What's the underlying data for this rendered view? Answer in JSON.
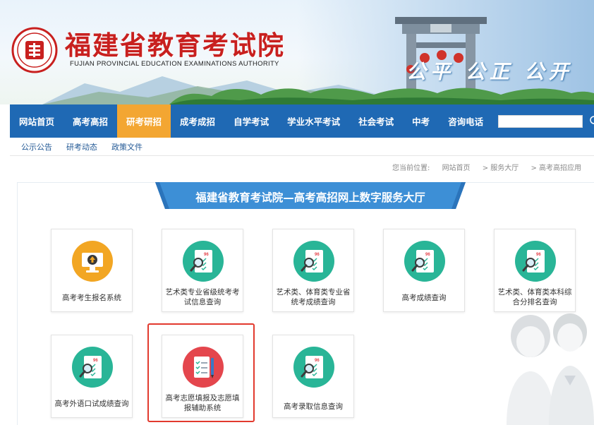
{
  "header": {
    "title": "福建省教育考试院",
    "subtitle": "FUJIAN PROVINCIAL EDUCATION EXAMINATIONS AUTHORITY",
    "slogan": "公平 公正 公开",
    "seal_icon": "exam-authority-seal"
  },
  "nav": {
    "items": [
      {
        "label": "网站首页",
        "active": false
      },
      {
        "label": "高考高招",
        "active": false
      },
      {
        "label": "研考研招",
        "active": true
      },
      {
        "label": "成考成招",
        "active": false
      },
      {
        "label": "自学考试",
        "active": false
      },
      {
        "label": "学业水平考试",
        "active": false
      },
      {
        "label": "社会考试",
        "active": false
      },
      {
        "label": "中考",
        "active": false
      },
      {
        "label": "咨询电话",
        "active": false
      }
    ],
    "search_value": "",
    "search_icon": "search-icon"
  },
  "subnav": {
    "items": [
      "公示公告",
      "研考动态",
      "政策文件"
    ]
  },
  "breadcrumb": {
    "prefix": "您当前位置:",
    "items": [
      "网站首页",
      "> 服务大厅",
      "> 高考高招应用"
    ]
  },
  "hall": {
    "title": "福建省教育考试院—高考高招网上数字服务大厅"
  },
  "services": [
    {
      "label": "高考考生报名系统",
      "icon": "upload-monitor-icon",
      "color": "#f2a623"
    },
    {
      "label": "艺术类专业省级统考考试信息查询",
      "icon": "score-query-icon",
      "color": "#29b597"
    },
    {
      "label": "艺术类、体育类专业省统考成绩查询",
      "icon": "score-query-icon",
      "color": "#29b597"
    },
    {
      "label": "高考成绩查询",
      "icon": "score-query-icon",
      "color": "#29b597"
    },
    {
      "label": "艺术类、体育类本科综合分排名查询",
      "icon": "score-query-icon",
      "color": "#29b597"
    },
    {
      "label": "高考外语口试成绩查询",
      "icon": "score-query-icon",
      "color": "#29b597"
    },
    {
      "label": "高考志愿填报及志愿填报辅助系统",
      "icon": "checklist-pen-icon",
      "color": "#e4464d"
    },
    {
      "label": "高考录取信息查询",
      "icon": "score-query-icon",
      "color": "#29b597"
    }
  ],
  "colors": {
    "nav": "#1f69b4",
    "nav_active": "#f3a632",
    "title_red": "#c8201f",
    "ribbon": "#3d8fd6",
    "highlight": "#e23a2e"
  }
}
